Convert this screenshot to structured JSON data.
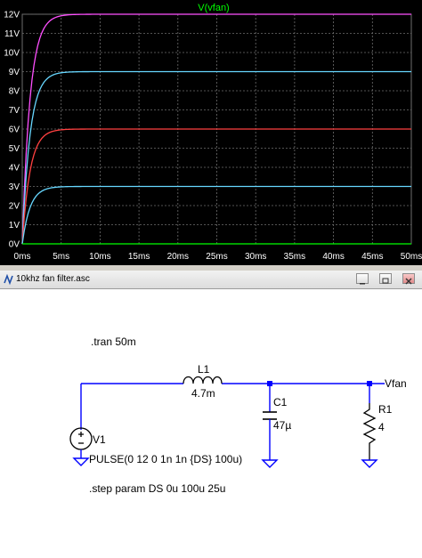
{
  "plot": {
    "title": "V(vfan)",
    "colors": {
      "background": "#000000",
      "grid": "#6e6e6e",
      "axis": "#00b050",
      "title": "#00ff00",
      "tick_text": "#ffffff"
    },
    "chart_data": {
      "type": "line",
      "title": "V(vfan)",
      "xlim": [
        0,
        50
      ],
      "ylim": [
        0,
        12
      ],
      "x_ticks": [
        "0ms",
        "5ms",
        "10ms",
        "15ms",
        "20ms",
        "25ms",
        "30ms",
        "35ms",
        "40ms",
        "45ms",
        "50ms"
      ],
      "y_ticks": [
        "0V",
        "1V",
        "2V",
        "3V",
        "4V",
        "5V",
        "6V",
        "7V",
        "8V",
        "9V",
        "10V",
        "11V",
        "12V"
      ],
      "grid": true,
      "series": [
        {
          "color": "#ff4fff",
          "final": 12,
          "tau_ms": 1.0,
          "x": [
            0,
            1,
            2,
            3,
            4,
            5,
            50
          ],
          "y": [
            0,
            7.6,
            10.4,
            11.4,
            11.8,
            11.95,
            12
          ]
        },
        {
          "color": "#67d7ff",
          "final": 9,
          "tau_ms": 1.0,
          "x": [
            0,
            1,
            2,
            3,
            4,
            5,
            50
          ],
          "y": [
            0,
            5.7,
            7.8,
            8.55,
            8.85,
            8.96,
            9
          ]
        },
        {
          "color": "#ff4040",
          "final": 6,
          "tau_ms": 1.0,
          "x": [
            0,
            1,
            2,
            3,
            4,
            5,
            50
          ],
          "y": [
            0,
            3.8,
            5.2,
            5.7,
            5.9,
            5.97,
            6
          ]
        },
        {
          "color": "#67d7ff",
          "final": 3,
          "tau_ms": 1.0,
          "x": [
            0,
            1,
            2,
            3,
            4,
            5,
            50
          ],
          "y": [
            0,
            1.9,
            2.6,
            2.85,
            2.95,
            2.99,
            3
          ]
        },
        {
          "color": "#00ff00",
          "final": 0,
          "tau_ms": 1.0,
          "x": [
            0,
            50
          ],
          "y": [
            0,
            0
          ]
        }
      ]
    }
  },
  "window": {
    "title": "10khz fan filter.asc",
    "controls": [
      "minimize",
      "restore",
      "close"
    ]
  },
  "schematic": {
    "directive_tran": ".tran 50m",
    "directive_step": ".step param DS 0u 100u 25u",
    "L1": {
      "name": "L1",
      "value": "4.7m"
    },
    "C1": {
      "name": "C1",
      "value": "47µ"
    },
    "R1": {
      "name": "R1",
      "value": "4"
    },
    "V1": {
      "name": "V1",
      "value": "PULSE(0 12 0 1n 1n {DS} 100u)"
    },
    "net_label": "Vfan",
    "colors": {
      "wire": "#0000ff",
      "component": "#000000",
      "ground": "#0000ff",
      "junction": "#0000ff"
    }
  }
}
